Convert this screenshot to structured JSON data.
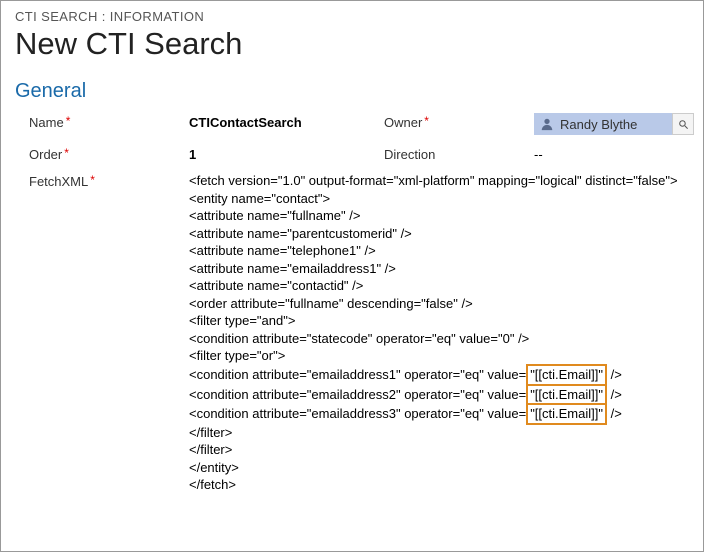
{
  "breadcrumb": "CTI SEARCH : INFORMATION",
  "page_title": "New CTI Search",
  "section_title": "General",
  "labels": {
    "name": "Name",
    "owner": "Owner",
    "order": "Order",
    "direction": "Direction",
    "fetchxml": "FetchXML"
  },
  "values": {
    "name": "CTIContactSearch",
    "order": "1",
    "direction": "--"
  },
  "owner": {
    "display_name": "Randy Blythe"
  },
  "fetchxml": {
    "lines": [
      "<fetch version=\"1.0\" output-format=\"xml-platform\" mapping=\"logical\" distinct=\"false\">",
      "<entity name=\"contact\">",
      "<attribute name=\"fullname\" />",
      "<attribute name=\"parentcustomerid\" />",
      "<attribute name=\"telephone1\" />",
      "<attribute name=\"emailaddress1\" />",
      "<attribute name=\"contactid\" />",
      "<order attribute=\"fullname\" descending=\"false\" />",
      "<filter type=\"and\">",
      " <condition attribute=\"statecode\" operator=\"eq\" value=\"0\" />",
      " <filter type=\"or\">"
    ],
    "email_conditions": [
      {
        "pre": "  <condition attribute=\"emailaddress1\" operator=\"eq\" value=",
        "hl": "\"[[cti.Email]]\"",
        "post": " />"
      },
      {
        "pre": "  <condition attribute=\"emailaddress2\" operator=\"eq\" value=",
        "hl": "\"[[cti.Email]]\"",
        "post": " />"
      },
      {
        "pre": "  <condition attribute=\"emailaddress3\" operator=\"eq\" value=",
        "hl": "\"[[cti.Email]]\"",
        "post": " />"
      }
    ],
    "closing": [
      " </filter>",
      "</filter>",
      "</entity>",
      "</fetch>"
    ]
  }
}
